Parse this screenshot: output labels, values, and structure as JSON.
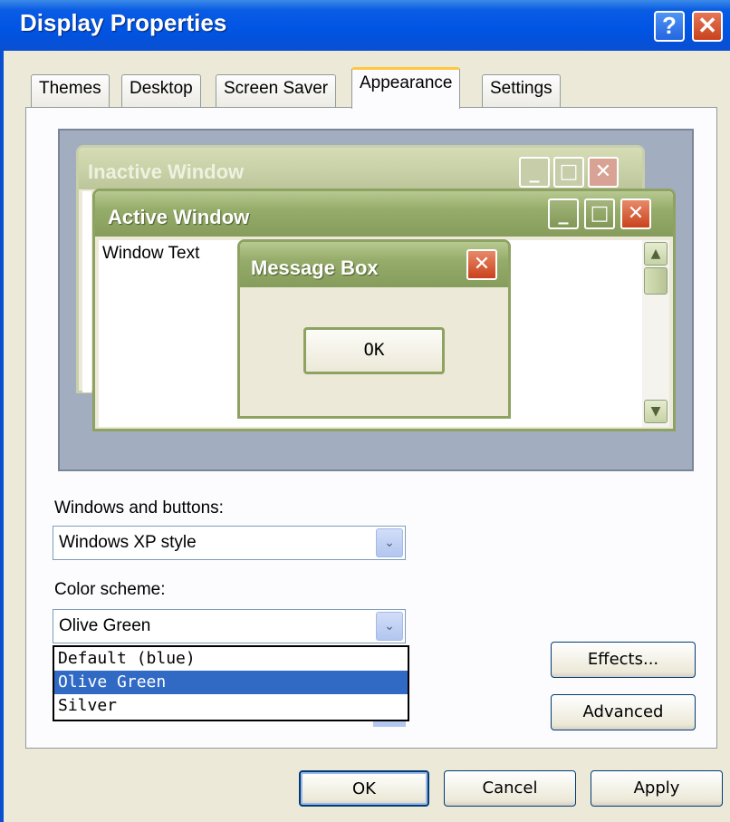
{
  "window": {
    "title": "Display Properties",
    "help_glyph": "?",
    "close_glyph": "✕"
  },
  "tabs": [
    {
      "label": "Themes"
    },
    {
      "label": "Desktop"
    },
    {
      "label": "Screen Saver"
    },
    {
      "label": "Appearance",
      "active": true
    },
    {
      "label": "Settings"
    }
  ],
  "preview": {
    "inactive_title": "Inactive Window",
    "active_title": "Active Window",
    "window_text": "Window Text",
    "message_title": "Message Box",
    "message_ok": "OK",
    "minimize_glyph": "_",
    "maximize_glyph": "□",
    "close_glyph": "✕",
    "scroll_up": "▲",
    "scroll_down": "▼"
  },
  "form": {
    "windows_buttons_label": "Windows and buttons:",
    "windows_buttons_value": "Windows XP style",
    "color_scheme_label": "Color scheme:",
    "color_scheme_value": "Olive Green",
    "dropdown_glyph": "⌄",
    "color_scheme_options": [
      "Default (blue)",
      "Olive Green",
      "Silver"
    ],
    "color_scheme_selected": "Olive Green"
  },
  "buttons": {
    "effects": "Effects...",
    "advanced": "Advanced",
    "ok": "OK",
    "cancel": "Cancel",
    "apply": "Apply"
  },
  "colors": {
    "titlebar": "#0054e3",
    "olive_caption": "#96ac6a",
    "selection": "#316ac5",
    "dialog_bg": "#ece9d8"
  }
}
